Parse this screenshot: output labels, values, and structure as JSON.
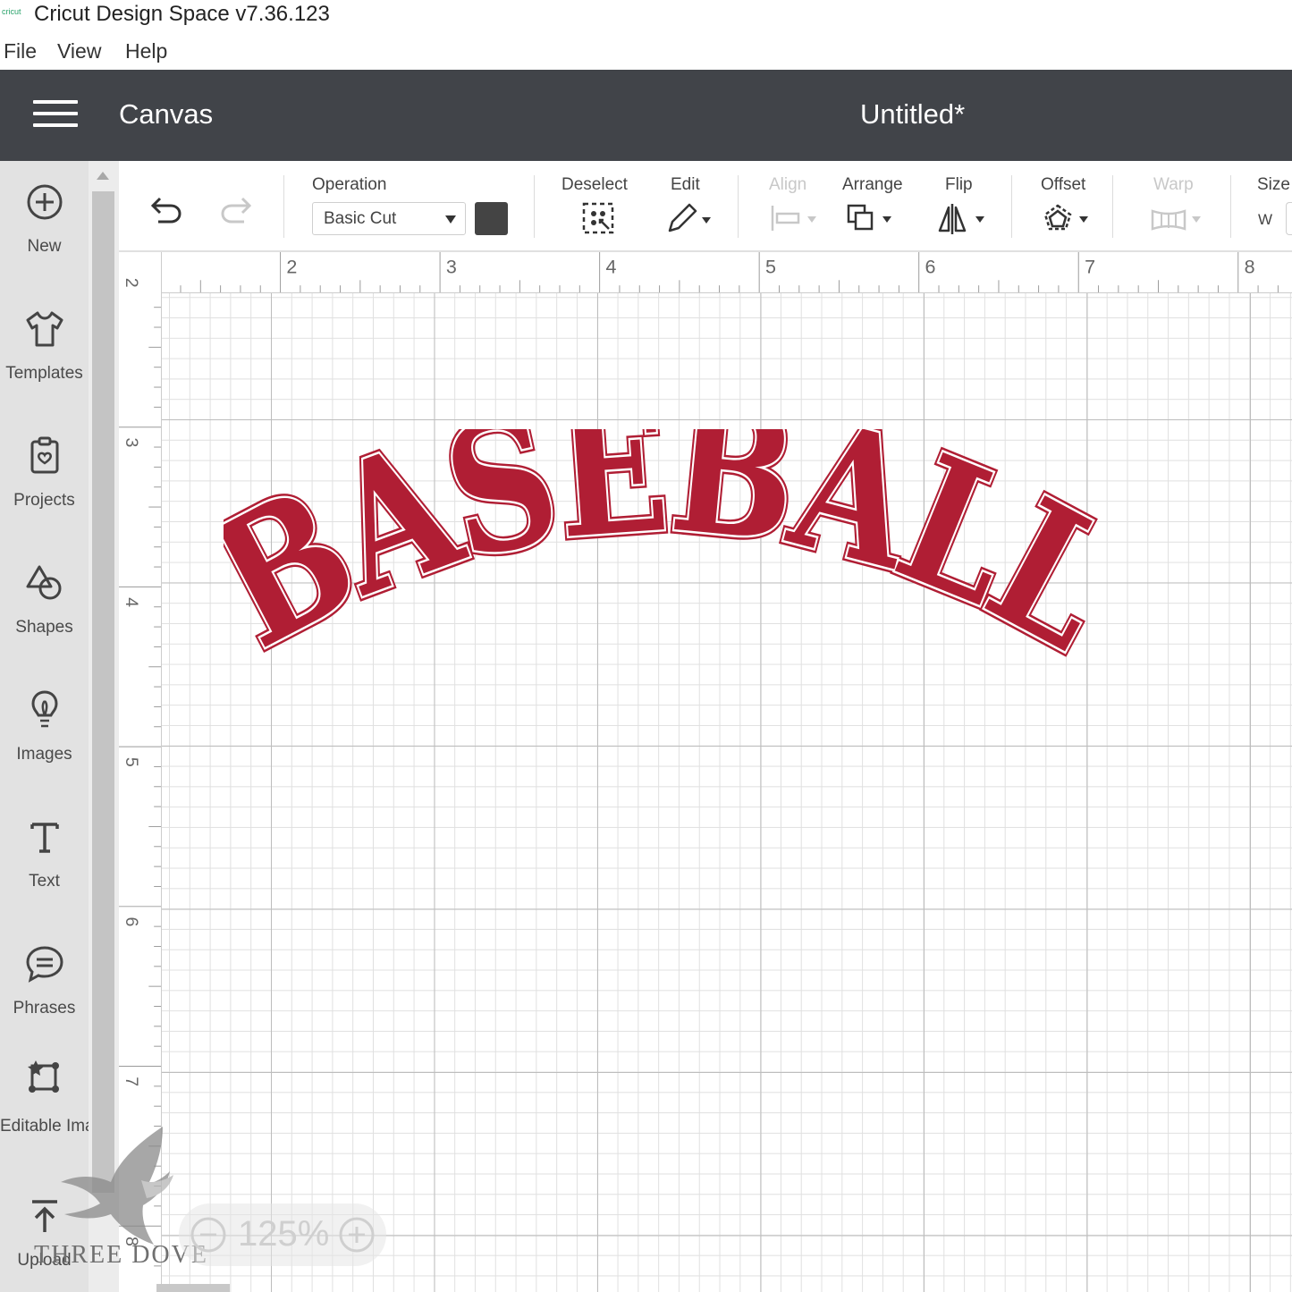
{
  "window": {
    "title": "Cricut Design Space  v7.36.123",
    "logo_text": "cricut"
  },
  "menu": [
    "File",
    "View",
    "Help"
  ],
  "header": {
    "section": "Canvas",
    "document": "Untitled*"
  },
  "left_panel": [
    {
      "label": "New",
      "icon": "plus-circle-icon"
    },
    {
      "label": "Templates",
      "icon": "tshirt-icon"
    },
    {
      "label": "Projects",
      "icon": "projects-icon"
    },
    {
      "label": "Shapes",
      "icon": "shapes-icon"
    },
    {
      "label": "Images",
      "icon": "lightbulb-icon"
    },
    {
      "label": "Text",
      "icon": "text-t-icon"
    },
    {
      "label": "Phrases",
      "icon": "speech-bubble-icon"
    },
    {
      "label": "Editable Images",
      "icon": "editable-image-icon"
    },
    {
      "label": "Upload",
      "icon": "upload-arrow-icon"
    }
  ],
  "toolbar": {
    "operation_label": "Operation",
    "operation_value": "Basic Cut",
    "operation_color": "#444444",
    "deselect_label": "Deselect",
    "edit_label": "Edit",
    "align_label": "Align",
    "arrange_label": "Arrange",
    "flip_label": "Flip",
    "offset_label": "Offset",
    "warp_label": "Warp",
    "size_label": "Size",
    "size_w_label": "W"
  },
  "ruler": {
    "top_marks": [
      "2",
      "3",
      "4",
      "5",
      "6",
      "7",
      "8"
    ],
    "left_marks": [
      "2",
      "3",
      "4",
      "5",
      "6",
      "7",
      "8"
    ]
  },
  "design": {
    "text": "BASEBALL",
    "fill_color": "#b01e34",
    "outline_color": "#ffffff"
  },
  "zoom": {
    "level": "125%"
  },
  "watermark": {
    "text": "THREE DOVE"
  }
}
